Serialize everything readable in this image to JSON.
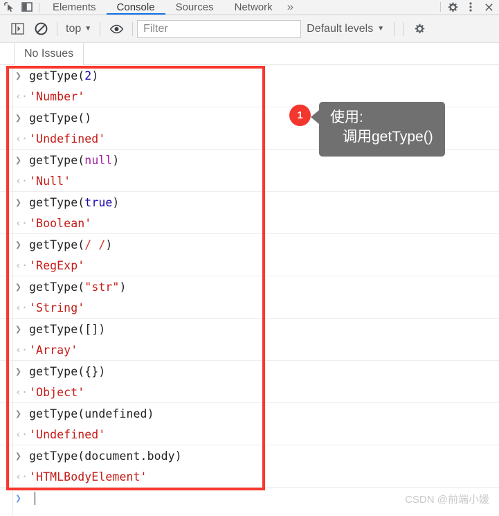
{
  "devtools": {
    "tabs": [
      {
        "label": "Elements",
        "active": false
      },
      {
        "label": "Console",
        "active": true
      },
      {
        "label": "Sources",
        "active": false
      },
      {
        "label": "Network",
        "active": false
      }
    ],
    "more_tabs_label": "»",
    "inspect_icon": "inspect-element-icon",
    "dock_icon": "dock-position-icon",
    "settings_icon": "gear-icon",
    "kebab_icon": "more-options-icon",
    "close_icon": "close-icon"
  },
  "console_toolbar": {
    "sidebar_toggle_icon": "console-sidebar-icon",
    "clear_icon": "clear-console-icon",
    "context_label": "top",
    "context_caret": "▼",
    "eye_icon": "live-expression-icon",
    "filter_placeholder": "Filter",
    "filter_value": "",
    "levels_label": "Default levels",
    "levels_caret": "▼",
    "settings_icon": "console-settings-icon"
  },
  "issues": {
    "tab_label": "No Issues"
  },
  "console": {
    "input_marker": "❯",
    "output_marker": "‹·",
    "entries": [
      {
        "input_parts": [
          {
            "t": "getType(",
            "c": "plain"
          },
          {
            "t": "2",
            "c": "num"
          },
          {
            "t": ")",
            "c": "plain"
          }
        ],
        "output": "'Number'"
      },
      {
        "input_parts": [
          {
            "t": "getType()",
            "c": "plain"
          }
        ],
        "output": "'Undefined'"
      },
      {
        "input_parts": [
          {
            "t": "getType(",
            "c": "plain"
          },
          {
            "t": "null",
            "c": "nul"
          },
          {
            "t": ")",
            "c": "plain"
          }
        ],
        "output": "'Null'"
      },
      {
        "input_parts": [
          {
            "t": "getType(",
            "c": "plain"
          },
          {
            "t": "true",
            "c": "kw"
          },
          {
            "t": ")",
            "c": "plain"
          }
        ],
        "output": "'Boolean'"
      },
      {
        "input_parts": [
          {
            "t": "getType(",
            "c": "plain"
          },
          {
            "t": "/ /",
            "c": "rgx"
          },
          {
            "t": ")",
            "c": "plain"
          }
        ],
        "output": "'RegExp'"
      },
      {
        "input_parts": [
          {
            "t": "getType(",
            "c": "plain"
          },
          {
            "t": "\"str\"",
            "c": "str"
          },
          {
            "t": ")",
            "c": "plain"
          }
        ],
        "output": "'String'"
      },
      {
        "input_parts": [
          {
            "t": "getType([])",
            "c": "plain"
          }
        ],
        "output": "'Array'"
      },
      {
        "input_parts": [
          {
            "t": "getType({})",
            "c": "plain"
          }
        ],
        "output": "'Object'"
      },
      {
        "input_parts": [
          {
            "t": "getType(undefined)",
            "c": "plain"
          }
        ],
        "output": "'Undefined'"
      },
      {
        "input_parts": [
          {
            "t": "getType(document.body)",
            "c": "plain"
          }
        ],
        "output": "'HTMLBodyElement'"
      }
    ],
    "prompt_marker": "❯",
    "prompt_value": ""
  },
  "annotation": {
    "badge_number": "1",
    "line1": "使用:",
    "line2": "调用getType()",
    "box_color": "#f9372e",
    "badge_color": "#f4372e",
    "bubble_color": "#707070"
  },
  "watermark": {
    "text": "CSDN @前端小媛"
  }
}
